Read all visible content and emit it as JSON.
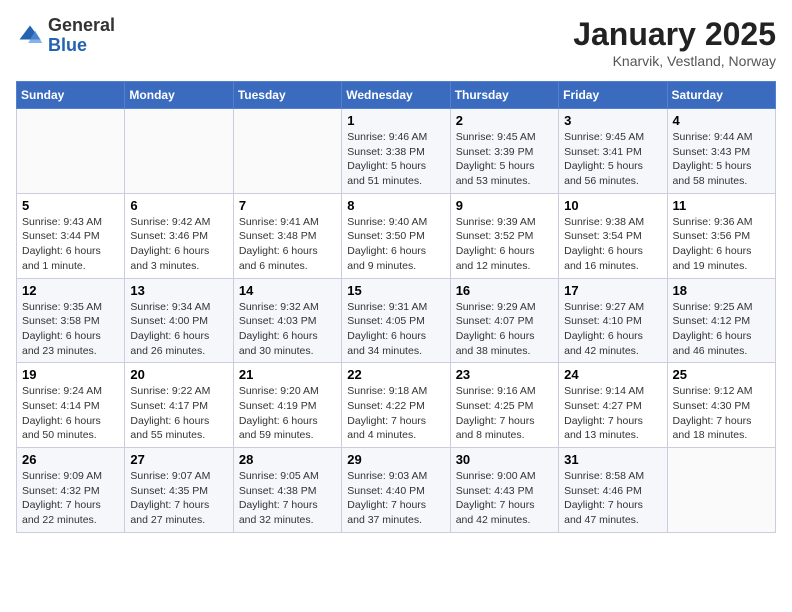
{
  "header": {
    "logo_general": "General",
    "logo_blue": "Blue",
    "month_title": "January 2025",
    "location": "Knarvik, Vestland, Norway"
  },
  "weekdays": [
    "Sunday",
    "Monday",
    "Tuesday",
    "Wednesday",
    "Thursday",
    "Friday",
    "Saturday"
  ],
  "weeks": [
    [
      {
        "day": "",
        "info": ""
      },
      {
        "day": "",
        "info": ""
      },
      {
        "day": "",
        "info": ""
      },
      {
        "day": "1",
        "info": "Sunrise: 9:46 AM\nSunset: 3:38 PM\nDaylight: 5 hours and 51 minutes."
      },
      {
        "day": "2",
        "info": "Sunrise: 9:45 AM\nSunset: 3:39 PM\nDaylight: 5 hours and 53 minutes."
      },
      {
        "day": "3",
        "info": "Sunrise: 9:45 AM\nSunset: 3:41 PM\nDaylight: 5 hours and 56 minutes."
      },
      {
        "day": "4",
        "info": "Sunrise: 9:44 AM\nSunset: 3:43 PM\nDaylight: 5 hours and 58 minutes."
      }
    ],
    [
      {
        "day": "5",
        "info": "Sunrise: 9:43 AM\nSunset: 3:44 PM\nDaylight: 6 hours and 1 minute."
      },
      {
        "day": "6",
        "info": "Sunrise: 9:42 AM\nSunset: 3:46 PM\nDaylight: 6 hours and 3 minutes."
      },
      {
        "day": "7",
        "info": "Sunrise: 9:41 AM\nSunset: 3:48 PM\nDaylight: 6 hours and 6 minutes."
      },
      {
        "day": "8",
        "info": "Sunrise: 9:40 AM\nSunset: 3:50 PM\nDaylight: 6 hours and 9 minutes."
      },
      {
        "day": "9",
        "info": "Sunrise: 9:39 AM\nSunset: 3:52 PM\nDaylight: 6 hours and 12 minutes."
      },
      {
        "day": "10",
        "info": "Sunrise: 9:38 AM\nSunset: 3:54 PM\nDaylight: 6 hours and 16 minutes."
      },
      {
        "day": "11",
        "info": "Sunrise: 9:36 AM\nSunset: 3:56 PM\nDaylight: 6 hours and 19 minutes."
      }
    ],
    [
      {
        "day": "12",
        "info": "Sunrise: 9:35 AM\nSunset: 3:58 PM\nDaylight: 6 hours and 23 minutes."
      },
      {
        "day": "13",
        "info": "Sunrise: 9:34 AM\nSunset: 4:00 PM\nDaylight: 6 hours and 26 minutes."
      },
      {
        "day": "14",
        "info": "Sunrise: 9:32 AM\nSunset: 4:03 PM\nDaylight: 6 hours and 30 minutes."
      },
      {
        "day": "15",
        "info": "Sunrise: 9:31 AM\nSunset: 4:05 PM\nDaylight: 6 hours and 34 minutes."
      },
      {
        "day": "16",
        "info": "Sunrise: 9:29 AM\nSunset: 4:07 PM\nDaylight: 6 hours and 38 minutes."
      },
      {
        "day": "17",
        "info": "Sunrise: 9:27 AM\nSunset: 4:10 PM\nDaylight: 6 hours and 42 minutes."
      },
      {
        "day": "18",
        "info": "Sunrise: 9:25 AM\nSunset: 4:12 PM\nDaylight: 6 hours and 46 minutes."
      }
    ],
    [
      {
        "day": "19",
        "info": "Sunrise: 9:24 AM\nSunset: 4:14 PM\nDaylight: 6 hours and 50 minutes."
      },
      {
        "day": "20",
        "info": "Sunrise: 9:22 AM\nSunset: 4:17 PM\nDaylight: 6 hours and 55 minutes."
      },
      {
        "day": "21",
        "info": "Sunrise: 9:20 AM\nSunset: 4:19 PM\nDaylight: 6 hours and 59 minutes."
      },
      {
        "day": "22",
        "info": "Sunrise: 9:18 AM\nSunset: 4:22 PM\nDaylight: 7 hours and 4 minutes."
      },
      {
        "day": "23",
        "info": "Sunrise: 9:16 AM\nSunset: 4:25 PM\nDaylight: 7 hours and 8 minutes."
      },
      {
        "day": "24",
        "info": "Sunrise: 9:14 AM\nSunset: 4:27 PM\nDaylight: 7 hours and 13 minutes."
      },
      {
        "day": "25",
        "info": "Sunrise: 9:12 AM\nSunset: 4:30 PM\nDaylight: 7 hours and 18 minutes."
      }
    ],
    [
      {
        "day": "26",
        "info": "Sunrise: 9:09 AM\nSunset: 4:32 PM\nDaylight: 7 hours and 22 minutes."
      },
      {
        "day": "27",
        "info": "Sunrise: 9:07 AM\nSunset: 4:35 PM\nDaylight: 7 hours and 27 minutes."
      },
      {
        "day": "28",
        "info": "Sunrise: 9:05 AM\nSunset: 4:38 PM\nDaylight: 7 hours and 32 minutes."
      },
      {
        "day": "29",
        "info": "Sunrise: 9:03 AM\nSunset: 4:40 PM\nDaylight: 7 hours and 37 minutes."
      },
      {
        "day": "30",
        "info": "Sunrise: 9:00 AM\nSunset: 4:43 PM\nDaylight: 7 hours and 42 minutes."
      },
      {
        "day": "31",
        "info": "Sunrise: 8:58 AM\nSunset: 4:46 PM\nDaylight: 7 hours and 47 minutes."
      },
      {
        "day": "",
        "info": ""
      }
    ]
  ]
}
